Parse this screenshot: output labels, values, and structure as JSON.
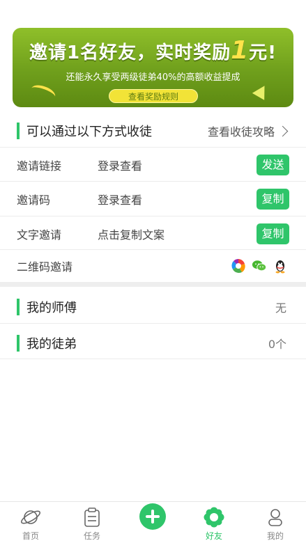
{
  "banner": {
    "title_prefix": "邀请1名好友，实时奖励",
    "title_amount": "1",
    "title_suffix": "元!",
    "subtitle": "还能永久享受两级徒弟40%的高额收益提成",
    "rules_button": "查看奖励规则"
  },
  "invite_section": {
    "heading": "可以通过以下方式收徒",
    "guide_link": "查看收徒攻略"
  },
  "invite_methods": [
    {
      "label": "邀请链接",
      "value": "登录查看",
      "action": "发送"
    },
    {
      "label": "邀请码",
      "value": "登录查看",
      "action": "复制"
    },
    {
      "label": "文字邀请",
      "value": "点击复制文案",
      "action": "复制"
    }
  ],
  "qr_invite": {
    "label": "二维码邀请",
    "share_icons": [
      "camera-icon",
      "wechat-icon",
      "qq-icon"
    ]
  },
  "master": {
    "heading": "我的师傅",
    "value": "无"
  },
  "apprentice": {
    "heading": "我的徒弟",
    "value": "0个"
  },
  "tabbar": {
    "tabs": [
      {
        "label": "首页",
        "icon": "planet-icon"
      },
      {
        "label": "任务",
        "icon": "clipboard-icon"
      },
      {
        "label": "",
        "icon": "add-icon"
      },
      {
        "label": "好友",
        "icon": "flower-icon"
      },
      {
        "label": "我的",
        "icon": "user-icon"
      }
    ],
    "active_index": 3
  },
  "colors": {
    "accent": "#2fc56a",
    "banner_green": "#7aaa22",
    "banner_yellow": "#ffe34a"
  }
}
